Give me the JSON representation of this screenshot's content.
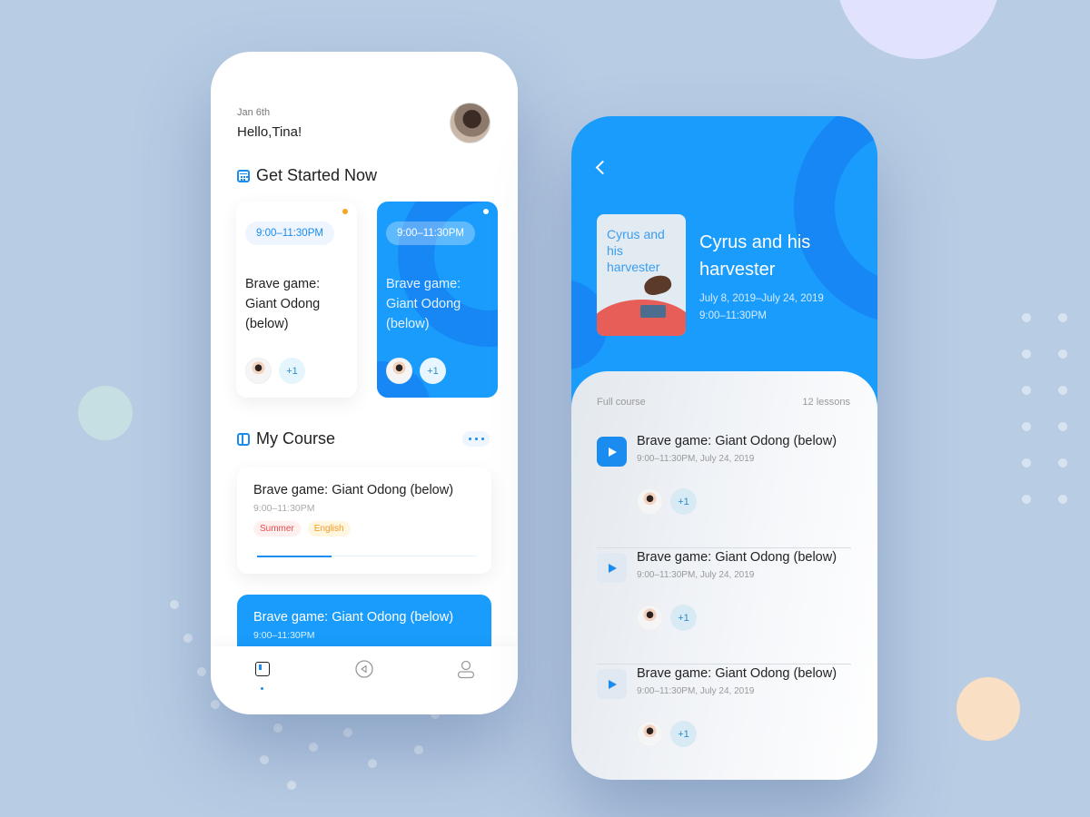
{
  "home": {
    "date": "Jan 6th",
    "greeting": "Hello,Tina!",
    "get_started": {
      "title": "Get Started Now",
      "cards": [
        {
          "time": "9:00–11:30PM",
          "title": "Brave game: Giant Odong (below)",
          "extra_count": "+1",
          "indicator_color": "#f5a623"
        },
        {
          "time": "9:00–11:30PM",
          "title": "Brave game: Giant Odong (below)",
          "extra_count": "+1",
          "indicator_color": "#ffffff"
        }
      ]
    },
    "my_course": {
      "title": "My Course",
      "courses": [
        {
          "title": "Brave game: Giant Odong (below)",
          "time": "9:00–11:30PM",
          "tags": [
            "Summer",
            "English"
          ],
          "progress": 0.34
        },
        {
          "title": "Brave game: Giant Odong (below)",
          "time": "9:00–11:30PM"
        }
      ]
    },
    "tabbar": [
      "home",
      "play",
      "profile"
    ]
  },
  "detail": {
    "cover_title": "Cyrus and his harvester",
    "title": "Cyrus and his harvester",
    "dates": "July 8, 2019–July 24, 2019",
    "time": "9:00–11:30PM",
    "section_label": "Full course",
    "lesson_count": "12 lessons",
    "lessons": [
      {
        "title": "Brave game: Giant Odong (below)",
        "meta": "9:00–11:30PM,  July 24, 2019",
        "extra_count": "+1",
        "active": true
      },
      {
        "title": "Brave game: Giant Odong (below)",
        "meta": "9:00–11:30PM,  July 24, 2019",
        "extra_count": "+1",
        "active": false
      },
      {
        "title": "Brave game: Giant Odong (below)",
        "meta": "9:00–11:30PM,  July 24, 2019",
        "extra_count": "+1",
        "active": false
      }
    ]
  },
  "colors": {
    "accent": "#199cfb",
    "background": "#b8cce4"
  }
}
